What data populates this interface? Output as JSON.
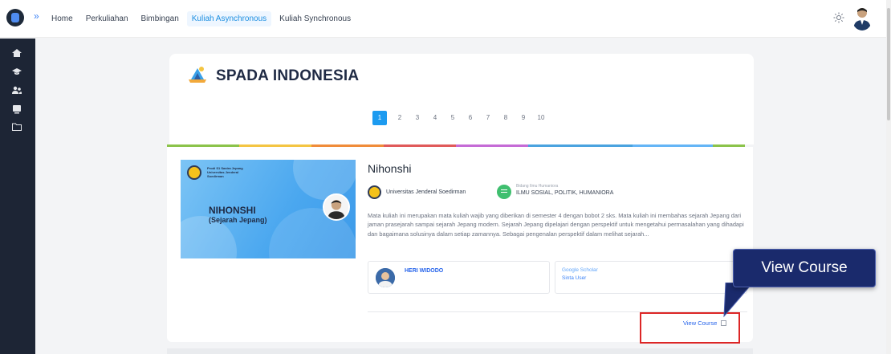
{
  "nav": {
    "items": [
      "Home",
      "Perkuliahan",
      "Bimbingan",
      "Kuliah Asynchronous",
      "Kuliah Synchronous"
    ],
    "active_index": 3
  },
  "brand": {
    "name": "SPADA INDONESIA"
  },
  "pagination": {
    "pages": [
      "1",
      "2",
      "3",
      "4",
      "5",
      "6",
      "7",
      "8",
      "9",
      "10"
    ],
    "current": "1"
  },
  "course": {
    "title": "Nihonshi",
    "thumbnail": {
      "title": "NIHONSHI",
      "subtitle": "(Sejarah Jepang)",
      "header_text": "Prodi S1 Sastra Jepang Universitas Jenderal Soedirman"
    },
    "university": "Universitas Jenderal Soedirman",
    "field_label": "Bidang Ilmu Humaniora",
    "field_value": "ILMU SOSIAL, POLITIK, HUMANIORA",
    "description": "Mata kuliah ini merupakan mata kuliah wajib yang diberikan di semester 4 dengan bobot 2 sks. Mata kuliah ini membahas sejarah Jepang dari jaman prasejarah sampai sejarah Jepang modern. Sejarah Jepang dipelajari dengan perspektif untuk mengetahui permasalahan yang dihadapi dan bagaimana solusinya dalam setiap zamannya. Sebagai pengenalan perspektif dalam melihat sejarah...",
    "lecturer": "HERI WIDODO",
    "links": [
      "Google Scholar",
      "Sinta User"
    ],
    "view_label": "View Course"
  },
  "callout": {
    "text": "View Course"
  },
  "colors": {
    "primary": "#1d9bf0",
    "sidebar": "#1d2535",
    "callout": "#1a2a6c",
    "highlight": "#dc2626",
    "stripe": [
      "#8bc34a",
      "#f4c542",
      "#f08c3a",
      "#e05a5a",
      "#c56bd6",
      "#4aa3df",
      "#64b5f6"
    ]
  },
  "icons": {
    "sidebar": [
      "home-icon",
      "graduation-cap-icon",
      "users-icon",
      "monitor-icon",
      "folder-icon"
    ],
    "topbar": [
      "app-logo-icon",
      "expand-sidebar-icon",
      "theme-toggle-icon",
      "user-avatar"
    ]
  }
}
